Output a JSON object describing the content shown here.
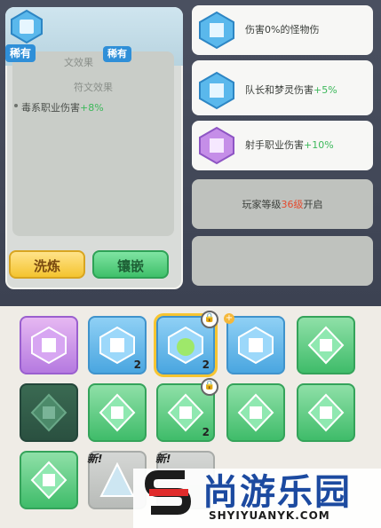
{
  "detail": {
    "rarity": "稀有",
    "rarity_tag": "稀有",
    "effect_header": "文效果",
    "effect_title": "符文效果",
    "effect_name": "毒系职业伤害",
    "effect_value": "+8%",
    "refine_label": "洗炼",
    "inlay_label": "镶嵌"
  },
  "slots": [
    {
      "text": "伤害0%的怪物伤",
      "value": ""
    },
    {
      "text": "物伤",
      "value": ""
    },
    {
      "text": "队长和梦灵伤害",
      "value": "+5%"
    },
    {
      "text": "射手职业伤害",
      "value": "+10%"
    }
  ],
  "locked_slot": {
    "prefix": "玩家等级",
    "level": "36级",
    "suffix": "开启"
  },
  "inventory": {
    "counts": [
      "2",
      "2",
      "2"
    ],
    "new_label": "新!"
  },
  "watermark": {
    "name": "尚游乐园",
    "url": "SHYIYUANYK.COM"
  },
  "colors": {
    "blue": "#4aa6e0",
    "green": "#3fbc6a",
    "purple": "#b57ae0",
    "gold": "#f7c531"
  }
}
